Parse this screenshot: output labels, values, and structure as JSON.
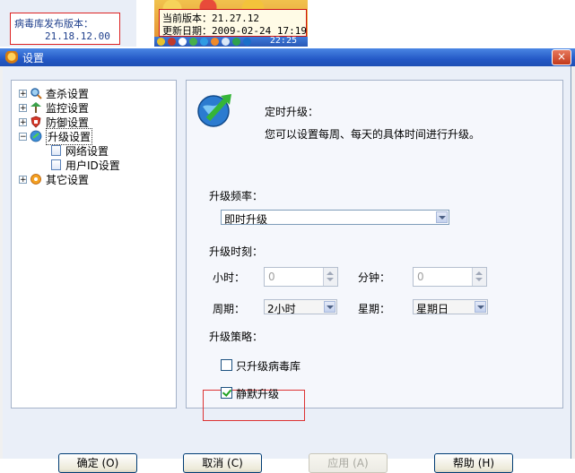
{
  "background": {
    "virus_db_label": "病毒库发布版本：",
    "virus_db_version": "21.18.12.00",
    "tooltip_version": "当前版本：21.27.12",
    "tooltip_date": "更新日期：2009-02-24 17:19",
    "tray_time": "22:25"
  },
  "dialog": {
    "title": "设置",
    "close_label": "×"
  },
  "tree": {
    "items": [
      {
        "label": "查杀设置",
        "icon": "scan-icon",
        "expander": "+"
      },
      {
        "label": "监控设置",
        "icon": "monitor-icon",
        "expander": "+"
      },
      {
        "label": "防御设置",
        "icon": "defense-icon",
        "expander": "+"
      },
      {
        "label": "升级设置",
        "icon": "upgrade-icon",
        "expander": "−",
        "selected": true
      },
      {
        "label": "网络设置",
        "icon": "document-icon",
        "child": true
      },
      {
        "label": "用户ID设置",
        "icon": "document-icon",
        "child": true
      },
      {
        "label": "其它设置",
        "icon": "other-settings-icon",
        "expander": "+"
      }
    ]
  },
  "panel": {
    "title": "定时升级：",
    "description": "您可以设置每周、每天的具体时间进行升级。",
    "frequency_label": "升级频率：",
    "frequency_value": "即时升级",
    "time_label": "升级时刻：",
    "hour_label": "小时：",
    "hour_value": "0",
    "minute_label": "分钟：",
    "minute_value": "0",
    "period_label": "周期：",
    "period_value": "2小时",
    "weekday_label": "星期：",
    "weekday_value": "星期日",
    "strategy_label": "升级策略：",
    "virus_only_label": "只升级病毒库",
    "virus_only_checked": false,
    "silent_label": "静默升级",
    "silent_checked": true
  },
  "buttons": {
    "ok": "确定 (O)",
    "cancel": "取消 (C)",
    "apply": "应用 (A)",
    "help": "帮助 (H)"
  }
}
